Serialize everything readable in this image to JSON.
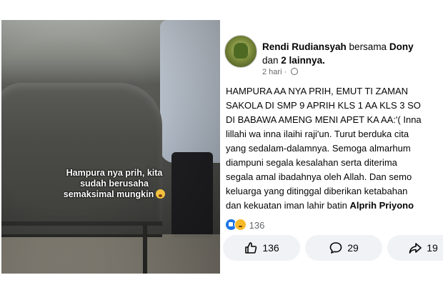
{
  "story": {
    "caption_lines": [
      "Hampura nya prih, kita",
      "sudah berusaha",
      "semaksimal mungkin"
    ],
    "caption_emoji": "crying-face-emoji"
  },
  "post": {
    "author": "Rendi Rudiansyah",
    "with_word": "bersama",
    "tagged": "Dony",
    "and_word": "dan",
    "others": "2 lainnya.",
    "time": "2 hari",
    "separator": "·",
    "privacy_icon": "globe-icon",
    "body_lines": [
      "HAMPURA AA NYA PRIH, EMUT TI ZAMAN",
      "SAKOLA DI SMP 9 APRIH KLS 1 AA KLS 3 SO",
      "DI BABAWA AMENG MENI APET KA AA:'( Inna",
      "lillahi wa inna ilaihi raji'un. Turut berduka cita",
      "yang sedalam-dalamnya. Semoga almarhum",
      "diampuni segala kesalahan serta diterima",
      "segala amal ibadahnya oleh Allah. Dan semo",
      "keluarga yang ditinggal diberikan ketabahan"
    ],
    "last_line_text": "dan kekuatan iman lahir batin",
    "last_line_name": "Alprih Priyono",
    "reaction_count": "136",
    "reaction_icons": [
      "like-icon",
      "sad-icon"
    ]
  },
  "actions": {
    "like_count": "136",
    "comment_count": "29",
    "share_count": "19"
  },
  "colors": {
    "brand_blue": "#1b74e4",
    "button_bg": "#f0f2f5",
    "secondary_text": "#65676b"
  }
}
